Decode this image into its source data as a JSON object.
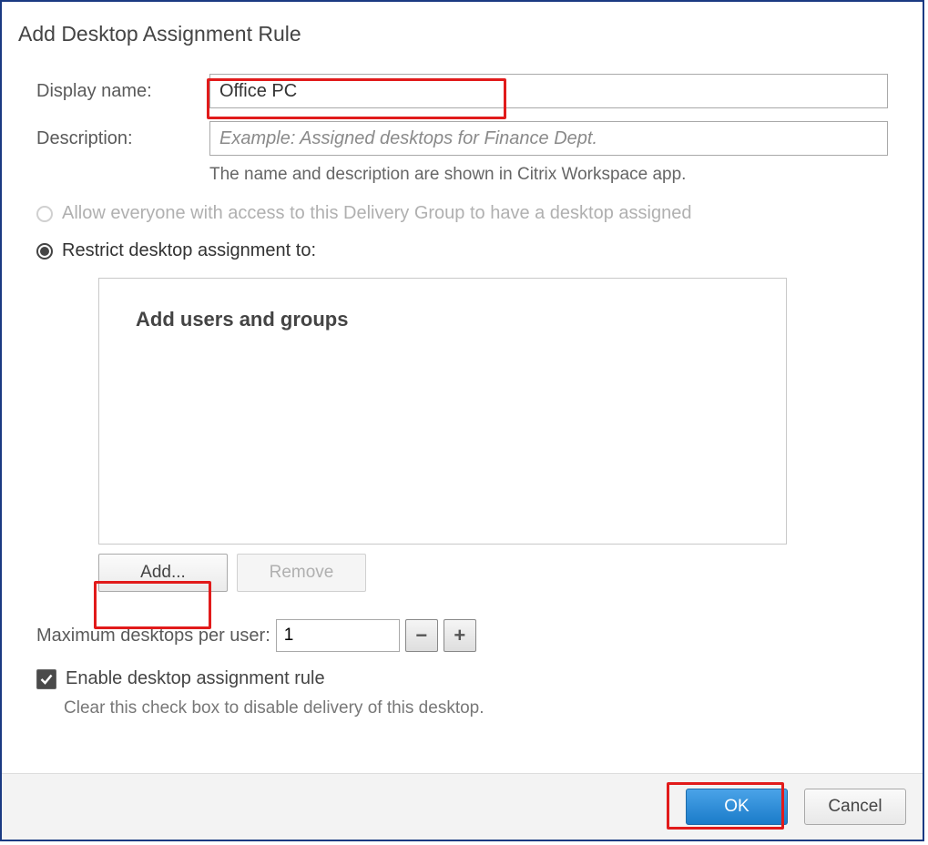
{
  "dialog_title": "Add Desktop Assignment Rule",
  "display_name": {
    "label": "Display name:",
    "value": "Office PC"
  },
  "description": {
    "label": "Description:",
    "value": "",
    "placeholder": "Example: Assigned desktops for Finance Dept."
  },
  "hint": "The name and description are shown in Citrix Workspace app.",
  "radio_allow_all": "Allow everyone with access to this Delivery Group to have a desktop assigned",
  "radio_restrict": "Restrict desktop assignment to:",
  "panel_title": "Add users and groups",
  "buttons": {
    "add": "Add...",
    "remove": "Remove"
  },
  "max": {
    "label": "Maximum desktops per user:",
    "value": "1",
    "minus": "−",
    "plus": "+"
  },
  "enable": {
    "label": "Enable desktop assignment rule",
    "checked": true
  },
  "enable_hint": "Clear this check box to disable delivery of this desktop.",
  "footer": {
    "ok": "OK",
    "cancel": "Cancel"
  }
}
